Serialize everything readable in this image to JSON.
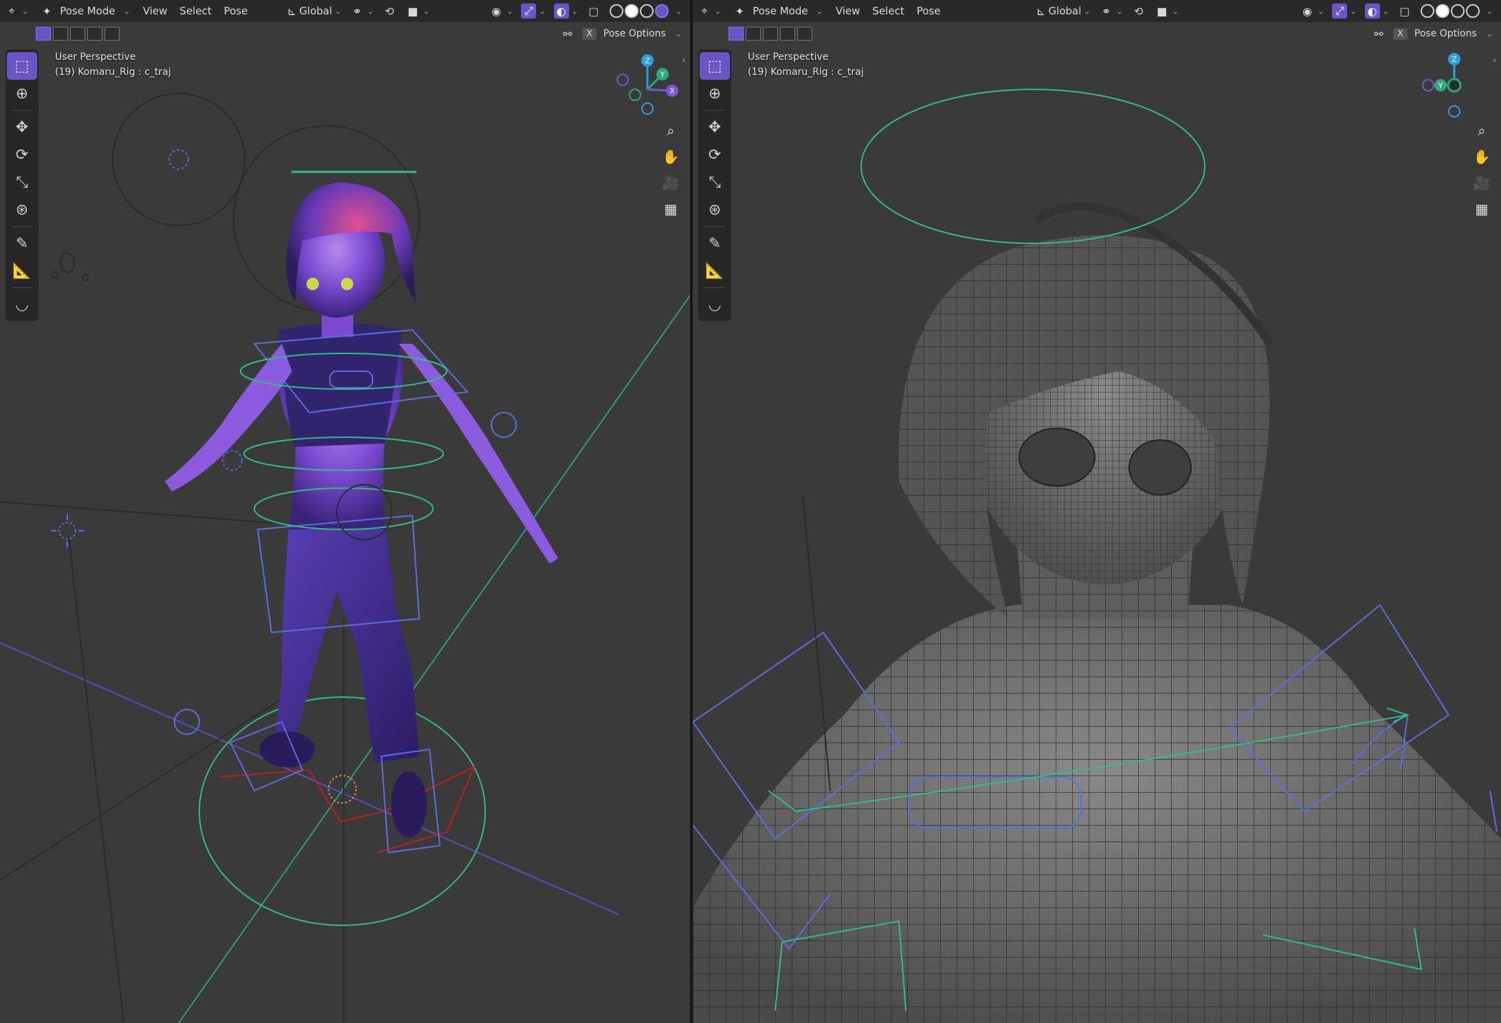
{
  "left": {
    "header": {
      "mode": "Pose Mode",
      "menus": [
        "View",
        "Select",
        "Pose"
      ],
      "orientation": "Global"
    },
    "pose_options": "Pose Options",
    "x_button": "X",
    "view_name": "User Perspective",
    "object_info": "(19) Komaru_Rig : c_traj"
  },
  "right": {
    "header": {
      "mode": "Pose Mode",
      "menus": [
        "View",
        "Select",
        "Pose"
      ],
      "orientation": "Global"
    },
    "pose_options": "Pose Options",
    "x_button": "X",
    "view_name": "User Perspective",
    "object_info": "(19) Komaru_Rig : c_traj"
  },
  "gizmo_axes": {
    "x": "X",
    "y": "Y",
    "z": "Z"
  },
  "colors": {
    "accent": "#6b55c9",
    "viewport_bg": "#3a3a3a",
    "header_bg": "#282828",
    "bone_blue": "#5c6fe0",
    "bone_green": "#2fbf8a",
    "axis_x": "#7a55d8",
    "axis_y": "#2fa882",
    "axis_z": "#2e9fe0"
  },
  "icons": {
    "editor_type": "editor-type-icon",
    "pose_mode": "pose-mode-icon",
    "orientation": "transform-orientation-icon",
    "pivot": "pivot-icon",
    "snap": "snap-icon",
    "visibility": "visibility-icon",
    "gizmo": "gizmo-icon",
    "overlay": "overlay-icon",
    "xray": "xray-icon"
  }
}
